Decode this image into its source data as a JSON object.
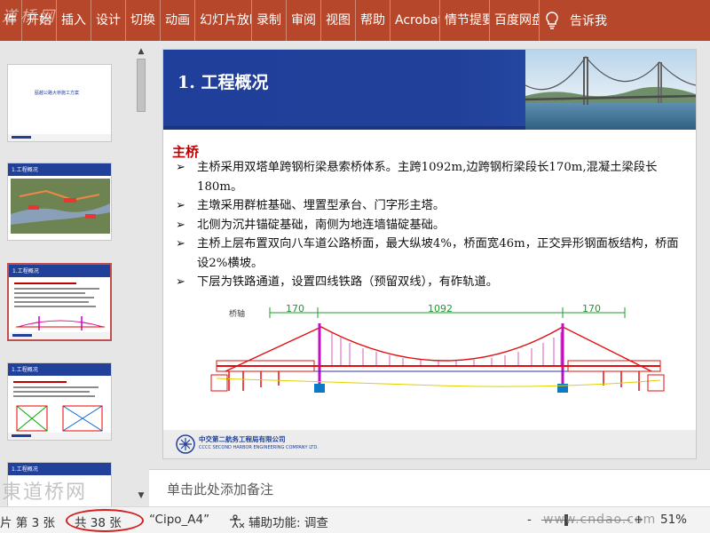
{
  "app": {
    "watermark_top": "道桥网",
    "watermark_url": "www.cndao.com"
  },
  "ribbon": {
    "tabs": [
      {
        "label": "件"
      },
      {
        "label": "开始"
      },
      {
        "label": "插入"
      },
      {
        "label": "设计"
      },
      {
        "label": "切换"
      },
      {
        "label": "动画"
      },
      {
        "label": "幻灯片放映"
      },
      {
        "label": "录制"
      },
      {
        "label": "审阅"
      },
      {
        "label": "视图"
      },
      {
        "label": "帮助"
      },
      {
        "label": "Acrobat"
      },
      {
        "label": "情节提要"
      },
      {
        "label": "百度网盘"
      }
    ],
    "tell_me": "告诉我",
    "tell_me_icon": "lightbulb-icon"
  },
  "thumbnails": {
    "slide1_title": "瓯越公路大桥施工方案",
    "slide2_title": "1.工程概况",
    "slide3_title": "1.工程概况",
    "slide4_title": "1.工程概况",
    "slide5_title": "1.工程概况",
    "watermark": "東道桥网"
  },
  "slide": {
    "title": "1. 工程概况",
    "section": "主桥",
    "bullet_mark": "➢",
    "bullets": [
      "主桥采用双塔单跨钢桁梁悬索桥体系。主跨1092m,边跨钢桁梁段长170m,混凝土梁段长180m。",
      "主墩采用群桩基础、埋置型承台、门字形主塔。",
      "北侧为沉井锚碇基础，南侧为地连墙锚碇基础。",
      "主桥上层布置双向八车道公路桥面，最大纵坡4%，桥面宽46m，正交异形钢面板结构，桥面设2%横坡。",
      "下层为铁路通道，设置四线铁路（预留双线），有砟轨道。"
    ],
    "drawing": {
      "left_label": "桥轴",
      "span_left": "170",
      "span_main": "1092",
      "span_right": "170"
    },
    "footer": {
      "company_cn": "中交第二航务工程局有限公司",
      "company_en": "CCCC SECOND HARBOR ENGINEERING COMPANY LTD."
    }
  },
  "notes": {
    "placeholder": "单击此处添加备注"
  },
  "status": {
    "slide_index": "片 第 3 张",
    "slide_total": "共 38 张",
    "layout": "“Cipo_A4”",
    "accessibility": "辅助功能: 调查",
    "zoom_minus": "-",
    "zoom_plus": "+",
    "zoom": "51%"
  },
  "colors": {
    "ribbon": "#b7472a",
    "slide_header": "#21409a",
    "section": "#c00000",
    "highlight_circle": "#d62020"
  }
}
